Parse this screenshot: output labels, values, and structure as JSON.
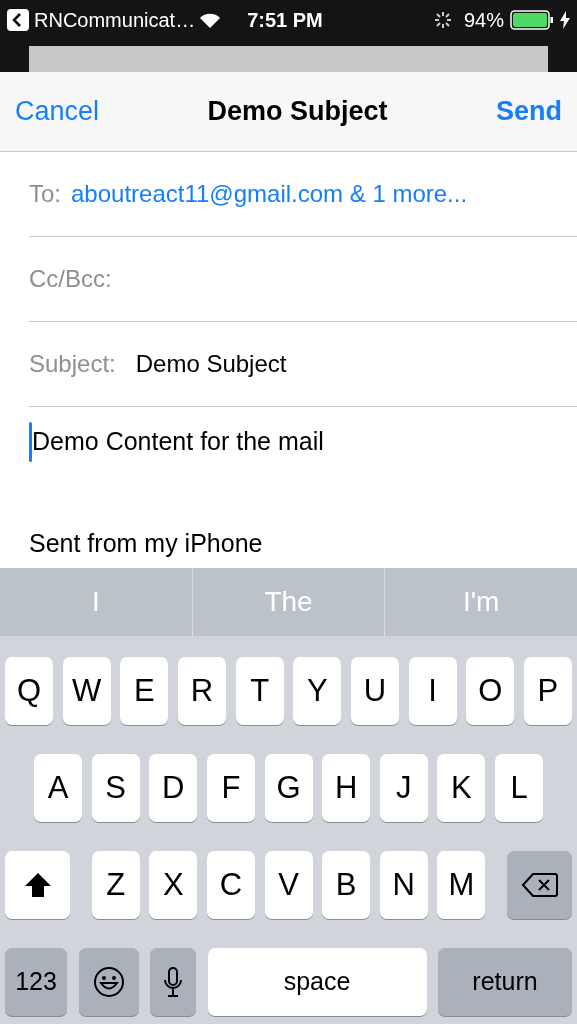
{
  "status_bar": {
    "back_app": "RNCommunicat…",
    "time": "7:51 PM",
    "battery": "94%"
  },
  "nav": {
    "cancel": "Cancel",
    "title": "Demo Subject",
    "send": "Send"
  },
  "fields": [
    {
      "label": "To:",
      "value": "aboutreact11@gmail.com & 1 more...",
      "kind": "recipients"
    },
    {
      "label": "Cc/Bcc:",
      "kind": "recipients"
    },
    {
      "label": "Subject:",
      "value": "Demo Subject",
      "kind": "subject"
    }
  ],
  "body": [
    "Demo Content for the mail",
    "Sent from my iPhone"
  ],
  "suggestions": [
    "I",
    "The",
    "I'm"
  ],
  "keyboard": [
    [
      {
        "kind": "letter",
        "label": "Q"
      },
      {
        "kind": "letter",
        "label": "W"
      },
      {
        "kind": "letter",
        "label": "E"
      },
      {
        "kind": "letter",
        "label": "R"
      },
      {
        "kind": "letter",
        "label": "T"
      },
      {
        "kind": "letter",
        "label": "Y"
      },
      {
        "kind": "letter",
        "label": "U"
      },
      {
        "kind": "letter",
        "label": "I"
      },
      {
        "kind": "letter",
        "label": "O"
      },
      {
        "kind": "letter",
        "label": "P"
      }
    ],
    [
      {
        "kind": "letter",
        "label": "A"
      },
      {
        "kind": "letter",
        "label": "S"
      },
      {
        "kind": "letter",
        "label": "D"
      },
      {
        "kind": "letter",
        "label": "F"
      },
      {
        "kind": "letter",
        "label": "G"
      },
      {
        "kind": "letter",
        "label": "H"
      },
      {
        "kind": "letter",
        "label": "J"
      },
      {
        "kind": "letter",
        "label": "K"
      },
      {
        "kind": "letter",
        "label": "L"
      }
    ],
    [
      {
        "kind": "shift"
      },
      {
        "kind": "letter",
        "label": "Z"
      },
      {
        "kind": "letter",
        "label": "X"
      },
      {
        "kind": "letter",
        "label": "C"
      },
      {
        "kind": "letter",
        "label": "V"
      },
      {
        "kind": "letter",
        "label": "B"
      },
      {
        "kind": "letter",
        "label": "N"
      },
      {
        "kind": "letter",
        "label": "M"
      },
      {
        "kind": "backspace"
      }
    ],
    [
      {
        "kind": "mode",
        "label": "123"
      },
      {
        "kind": "emoji"
      },
      {
        "kind": "mic"
      },
      {
        "kind": "space",
        "label": "space"
      },
      {
        "kind": "return",
        "label": "return"
      }
    ]
  ]
}
